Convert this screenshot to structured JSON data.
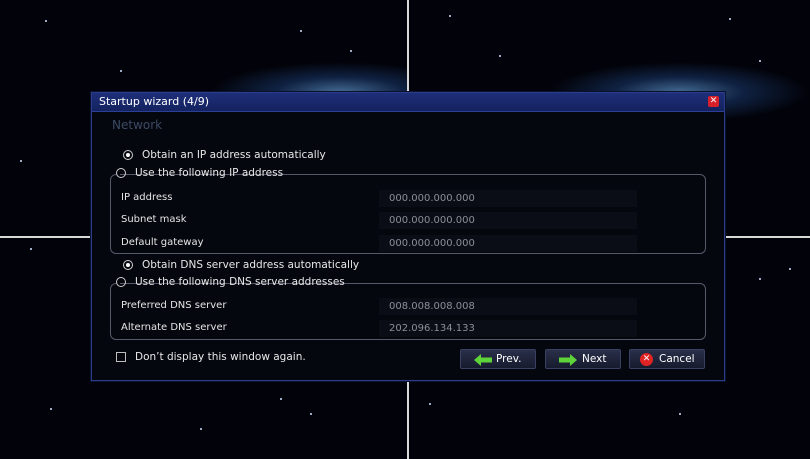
{
  "dialog": {
    "title": "Startup wizard (4/9)",
    "close_icon": "close-icon",
    "section_title": "Network",
    "ip": {
      "auto_label": "Obtain an IP address automatically",
      "auto_selected": true,
      "manual_label": "Use the following IP address",
      "fields": [
        {
          "label": "IP address",
          "value": "000.000.000.000"
        },
        {
          "label": "Subnet mask",
          "value": "000.000.000.000"
        },
        {
          "label": "Default gateway",
          "value": "000.000.000.000"
        }
      ]
    },
    "dns": {
      "auto_label": "Obtain DNS server address automatically",
      "auto_selected": true,
      "manual_label": "Use the following DNS server addresses",
      "fields": [
        {
          "label": "Preferred DNS server",
          "value": "008.008.008.008"
        },
        {
          "label": "Alternate DNS server",
          "value": "202.096.134.133"
        }
      ]
    },
    "dont_display_label": "Don’t display this window again.",
    "dont_display_checked": false,
    "buttons": {
      "prev": {
        "label": "Prev.",
        "icon": "arrow-left-icon"
      },
      "next": {
        "label": "Next",
        "icon": "arrow-right-icon"
      },
      "cancel": {
        "label": "Cancel",
        "icon": "cancel-icon"
      }
    }
  },
  "colors": {
    "titlebar": "#1e2f7a",
    "arrow_green": "#5fd43a",
    "cancel_red": "#e02424"
  }
}
